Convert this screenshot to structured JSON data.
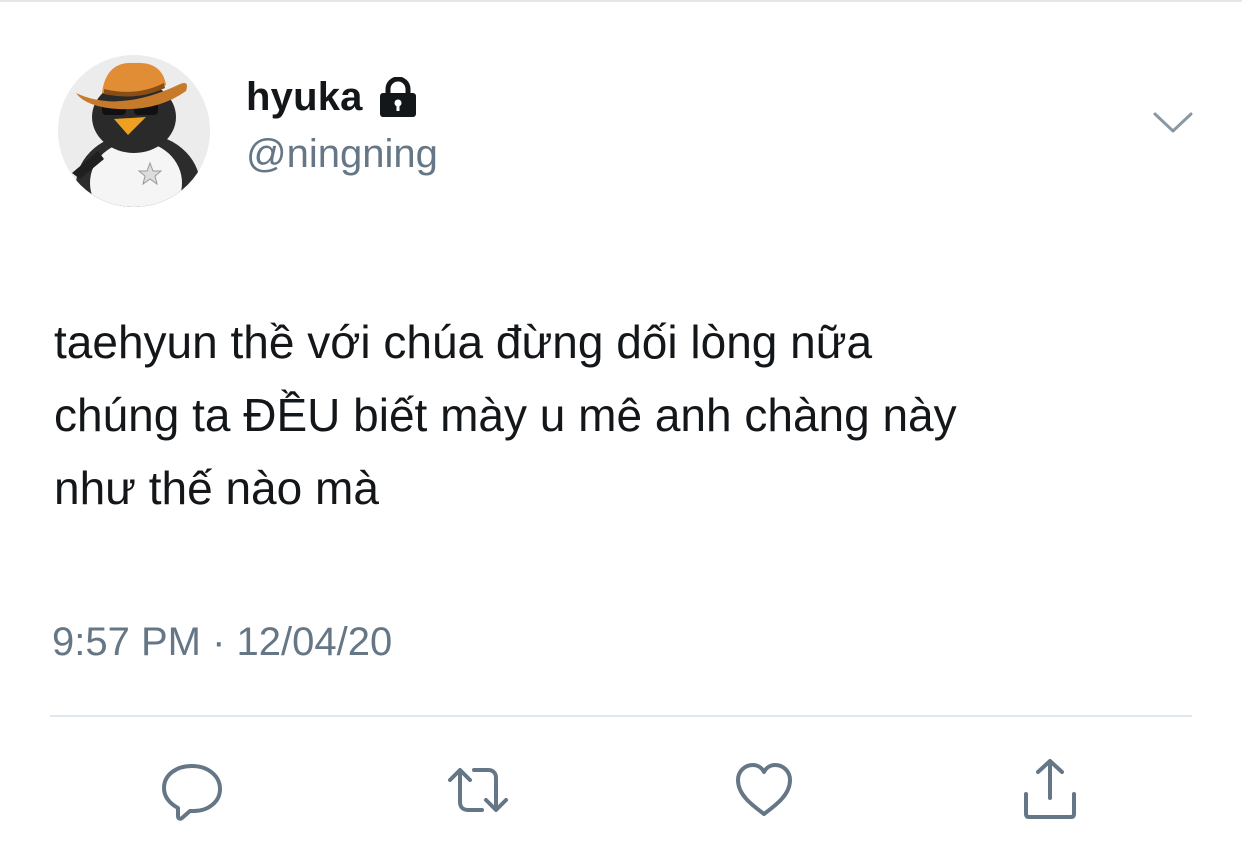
{
  "user": {
    "display_name": "hyuka",
    "handle": "@ningning",
    "protected_icon": "lock-icon",
    "avatar": "penguin-cowboy-hat-avatar"
  },
  "tweet": {
    "text": "taehyun thề với chúa đừng dối lòng nữa\nchúng ta ĐỀU biết mày u mê anh chàng này\nnhư thế nào mà",
    "timestamp": "9:57 PM · 12/04/20"
  },
  "actions": [
    {
      "icon": "reply-icon"
    },
    {
      "icon": "retweet-icon"
    },
    {
      "icon": "like-icon"
    },
    {
      "icon": "share-icon"
    }
  ],
  "menu_icon": "chevron-down-icon",
  "colors": {
    "text_primary": "#14171a",
    "text_secondary": "#657786",
    "icon": "#657786",
    "divider": "#e1e8ed"
  }
}
